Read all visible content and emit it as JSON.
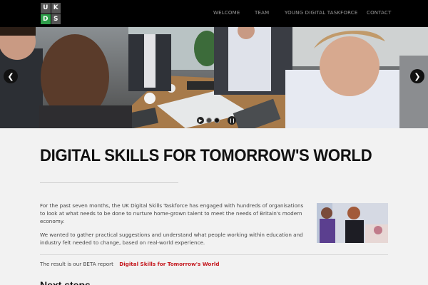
{
  "header": {
    "logo_letters": [
      "U",
      "K",
      "D",
      "S"
    ],
    "nav": [
      {
        "label": "WELCOME"
      },
      {
        "label": "TEAM"
      },
      {
        "label": "YOUNG DIGITAL TASKFORCE"
      },
      {
        "label": "CONTACT"
      }
    ]
  },
  "hero": {
    "prev_icon": "chevron-left-icon",
    "next_icon": "chevron-right-icon",
    "slides_count_shown": 2,
    "active_slide": 2
  },
  "main": {
    "title": "DIGITAL SKILLS FOR TOMORROW'S WORLD",
    "paragraph1": "For the past seven months, the UK Digital Skills Taskforce has engaged with hundreds of organisations to look at what needs to be done to nurture home-grown talent to meet the needs of Britain's modern economy.",
    "paragraph2": "We wanted to gather practical suggestions and understand what people working within education and industry felt needed to change, based on real-world experience.",
    "report_prefix": "The result is our BETA report",
    "report_link": "Digital Skills for Tomorrow's World",
    "next_heading": "Next steps"
  },
  "colors": {
    "topbar": "#000000",
    "logo_accent": "#2e9e4a",
    "link": "#c4161c",
    "background": "#f2f2f2"
  }
}
